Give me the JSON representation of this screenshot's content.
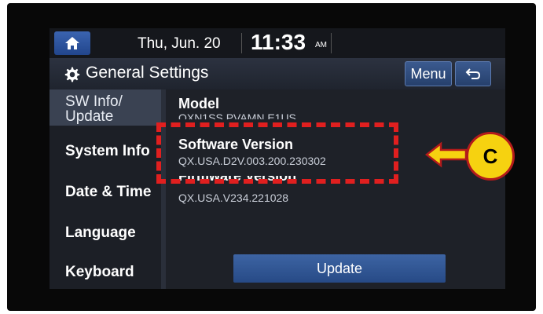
{
  "status_bar": {
    "date": "Thu, Jun. 20",
    "time": "11:33",
    "ampm": "AM"
  },
  "header": {
    "title": "General Settings",
    "menu_label": "Menu"
  },
  "sidebar": {
    "items": [
      {
        "label_line1": "SW Info/",
        "label_line2": "Update",
        "active": true
      },
      {
        "label": "System Info"
      },
      {
        "label": "Date & Time"
      },
      {
        "label": "Language"
      },
      {
        "label": "Keyboard"
      }
    ]
  },
  "main": {
    "model_label": "Model",
    "model_value": "QXN1SS PVAMN E1US",
    "software_label": "Software Version",
    "software_value": "QX.USA.D2V.003.200.230302",
    "firmware_label": "Firmware Version",
    "firmware_value": "QX.USA.V234.221028",
    "update_label": "Update"
  },
  "annotation": {
    "callout_letter": "C",
    "highlight_color": "#e01f1f",
    "circle_color": "#f6d210"
  },
  "icons": [
    "home-icon",
    "gear-icon",
    "back-icon",
    "left-arrow-icon"
  ]
}
